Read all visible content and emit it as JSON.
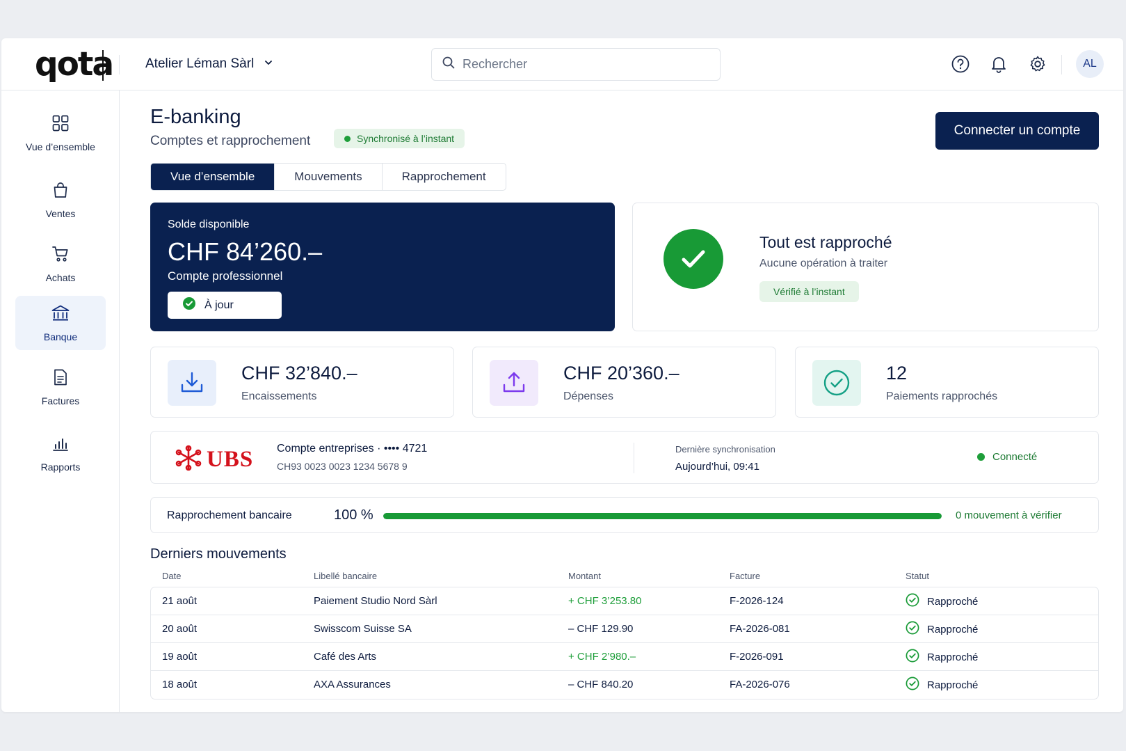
{
  "brand": {
    "logo_text": "qota"
  },
  "topbar": {
    "company": "Atelier Léman Sàrl",
    "search_placeholder": "Rechercher",
    "avatar_initials": "AL"
  },
  "sidebar": {
    "items": [
      {
        "label": "Vue d’ensemble",
        "icon": "grid-icon",
        "active": false
      },
      {
        "label": "Ventes",
        "icon": "shopping-bag-icon",
        "active": false
      },
      {
        "label": "Achats",
        "icon": "cart-icon",
        "active": false
      },
      {
        "label": "Banque",
        "icon": "bank-icon",
        "active": true
      },
      {
        "label": "Factures",
        "icon": "document-icon",
        "active": false
      },
      {
        "label": "Rapports",
        "icon": "bar-chart-icon",
        "active": false
      }
    ]
  },
  "page": {
    "title": "E-banking",
    "subtitle": "Comptes et rapprochement",
    "sync_badge": "Synchronisé à l’instant",
    "connect_button": "Connecter un compte"
  },
  "tabs": [
    {
      "label": "Vue d’ensemble",
      "active": true
    },
    {
      "label": "Mouvements",
      "active": false
    },
    {
      "label": "Rapprochement",
      "active": false
    }
  ],
  "balance": {
    "label": "Solde disponible",
    "amount": "CHF 84’260.–",
    "account": "Compte professionnel",
    "status": "À jour"
  },
  "reconciliation_card": {
    "title": "Tout est rapproché",
    "subtitle": "Aucune opération à traiter",
    "badge": "Vérifié à l’instant"
  },
  "stats": [
    {
      "value": "CHF 32’840.–",
      "label": "Encaissements",
      "icon": "download-icon",
      "color": "#1e5bd6"
    },
    {
      "value": "CHF 20’360.–",
      "label": "Dépenses",
      "icon": "upload-icon",
      "color": "#7c3aed"
    },
    {
      "value": "12",
      "label": "Paiements rapprochés",
      "icon": "check-circle-icon",
      "color": "#14a085"
    }
  ],
  "bank_account": {
    "bank_name": "UBS",
    "account_name": "Compte entreprises · •••• 4721",
    "iban": "CH93 0023 0023 1234 5678 9",
    "last_sync_label": "Dernière synchronisation",
    "last_sync_value": "Aujourd’hui, 09:41",
    "status": "Connecté"
  },
  "reconciliation_bar": {
    "label": "Rapprochement bancaire",
    "percent_text": "100 %",
    "progress": 1.0,
    "pending": "0 mouvement à vérifier"
  },
  "movements": {
    "title": "Derniers mouvements",
    "columns": [
      "Date",
      "Libellé bancaire",
      "Montant",
      "Facture",
      "Statut"
    ],
    "rows": [
      {
        "date": "21 août",
        "label": "Paiement Studio Nord Sàrl",
        "amount": "+ CHF 3’253.80",
        "credit": true,
        "invoice": "F-2026-124",
        "status": "Rapproché"
      },
      {
        "date": "20 août",
        "label": "Swisscom Suisse SA",
        "amount": "– CHF 129.90",
        "credit": false,
        "invoice": "FA-2026-081",
        "status": "Rapproché"
      },
      {
        "date": "19 août",
        "label": "Café des Arts",
        "amount": "+ CHF 2’980.–",
        "credit": true,
        "invoice": "F-2026-091",
        "status": "Rapproché"
      },
      {
        "date": "18 août",
        "label": "AXA Assurances",
        "amount": "– CHF 840.20",
        "credit": false,
        "invoice": "FA-2026-076",
        "status": "Rapproché"
      }
    ]
  },
  "colors": {
    "navy": "#0a2150",
    "success": "#189a36",
    "ubs_red": "#d4111b"
  }
}
